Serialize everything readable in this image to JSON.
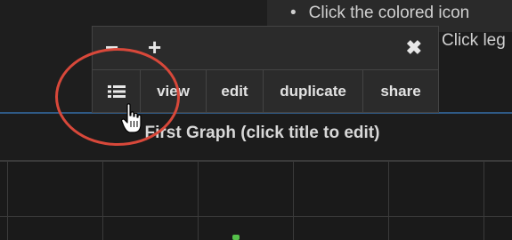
{
  "tips": {
    "bullet": "•",
    "line1": "Click the colored icon",
    "line2": "Click leg"
  },
  "toolbar": {
    "minus_icon": "minus-icon",
    "plus_icon": "plus-icon",
    "close_icon": "close-icon",
    "list_icon": "list-icon",
    "minus_glyph": "−",
    "plus_glyph": "+",
    "close_glyph": "✖",
    "buttons": {
      "view": "view",
      "edit": "edit",
      "duplicate": "duplicate",
      "share": "share"
    }
  },
  "graph": {
    "title": "First Graph (click title to edit)"
  },
  "colors": {
    "annotation": "#d8483a",
    "rule": "#2f5a86",
    "accent_point": "#55c04a"
  }
}
